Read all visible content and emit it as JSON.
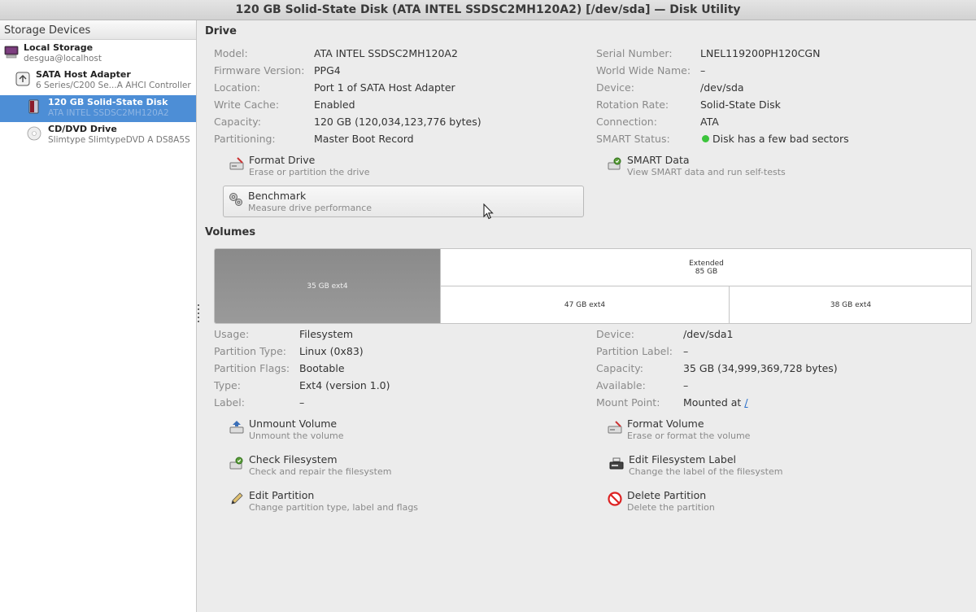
{
  "window": {
    "title": "120 GB Solid-State Disk (ATA INTEL SSDSC2MH120A2) [/dev/sda] — Disk Utility"
  },
  "sidebar": {
    "header": "Storage Devices",
    "items": [
      {
        "title": "Local Storage",
        "subtitle": "desgua@localhost",
        "icon": "computer-icon"
      },
      {
        "title": "SATA Host Adapter",
        "subtitle": "6 Series/C200 Se...A AHCI Controller",
        "icon": "controller-icon"
      },
      {
        "title": "120 GB Solid-State Disk",
        "subtitle": "ATA INTEL SSDSC2MH120A2",
        "icon": "ssd-icon",
        "selected": true
      },
      {
        "title": "CD/DVD Drive",
        "subtitle": "Slimtype SlimtypeDVD A  DS8A5S",
        "icon": "optical-drive-icon"
      }
    ]
  },
  "drive": {
    "section_title": "Drive",
    "left_fields": [
      {
        "label": "Model:",
        "value": "ATA INTEL SSDSC2MH120A2"
      },
      {
        "label": "Firmware Version:",
        "value": "PPG4"
      },
      {
        "label": "Location:",
        "value": "Port 1 of SATA Host Adapter"
      },
      {
        "label": "Write Cache:",
        "value": "Enabled"
      },
      {
        "label": "Capacity:",
        "value": "120 GB (120,034,123,776 bytes)"
      },
      {
        "label": "Partitioning:",
        "value": "Master Boot Record"
      }
    ],
    "right_fields": [
      {
        "label": "Serial Number:",
        "value": "LNEL119200PH120CGN"
      },
      {
        "label": "World Wide Name:",
        "value": "–"
      },
      {
        "label": "Device:",
        "value": "/dev/sda"
      },
      {
        "label": "Rotation Rate:",
        "value": "Solid-State Disk"
      },
      {
        "label": "Connection:",
        "value": "ATA"
      },
      {
        "label": "SMART Status:",
        "value": "Disk has a few bad sectors",
        "status_color": "#3cc43c"
      }
    ],
    "actions": {
      "format_drive": {
        "title": "Format Drive",
        "desc": "Erase or partition the drive"
      },
      "smart_data": {
        "title": "SMART Data",
        "desc": "View SMART data and run self-tests"
      },
      "benchmark": {
        "title": "Benchmark",
        "desc": "Measure drive performance"
      }
    }
  },
  "volumes": {
    "section_title": "Volumes",
    "map": {
      "primary": {
        "label": "35 GB ext4"
      },
      "extended": {
        "label": "Extended",
        "size": "85 GB"
      },
      "logical": [
        {
          "label": "47 GB ext4"
        },
        {
          "label": "38 GB ext4"
        }
      ]
    },
    "left_fields": [
      {
        "label": "Usage:",
        "value": "Filesystem"
      },
      {
        "label": "Partition Type:",
        "value": "Linux (0x83)"
      },
      {
        "label": "Partition Flags:",
        "value": "Bootable"
      },
      {
        "label": "Type:",
        "value": "Ext4 (version 1.0)"
      },
      {
        "label": "Label:",
        "value": "–"
      }
    ],
    "right_fields": [
      {
        "label": "Device:",
        "value": "/dev/sda1"
      },
      {
        "label": "Partition Label:",
        "value": "–"
      },
      {
        "label": "Capacity:",
        "value": "35 GB (34,999,369,728 bytes)"
      },
      {
        "label": "Available:",
        "value": "–"
      },
      {
        "label": "Mount Point:",
        "value": "Mounted at",
        "link": "/"
      }
    ],
    "actions": {
      "unmount": {
        "title": "Unmount Volume",
        "desc": "Unmount the volume"
      },
      "format_volume": {
        "title": "Format Volume",
        "desc": "Erase or format the volume"
      },
      "check_fs": {
        "title": "Check Filesystem",
        "desc": "Check and repair the filesystem"
      },
      "edit_label": {
        "title": "Edit Filesystem Label",
        "desc": "Change the label of the filesystem"
      },
      "edit_partition": {
        "title": "Edit Partition",
        "desc": "Change partition type, label and flags"
      },
      "delete_partition": {
        "title": "Delete Partition",
        "desc": "Delete the partition"
      }
    }
  },
  "colors": {
    "selection": "#4d8ed6",
    "status_ok": "#3cc43c",
    "volume_selected": "#8f8f8f"
  }
}
